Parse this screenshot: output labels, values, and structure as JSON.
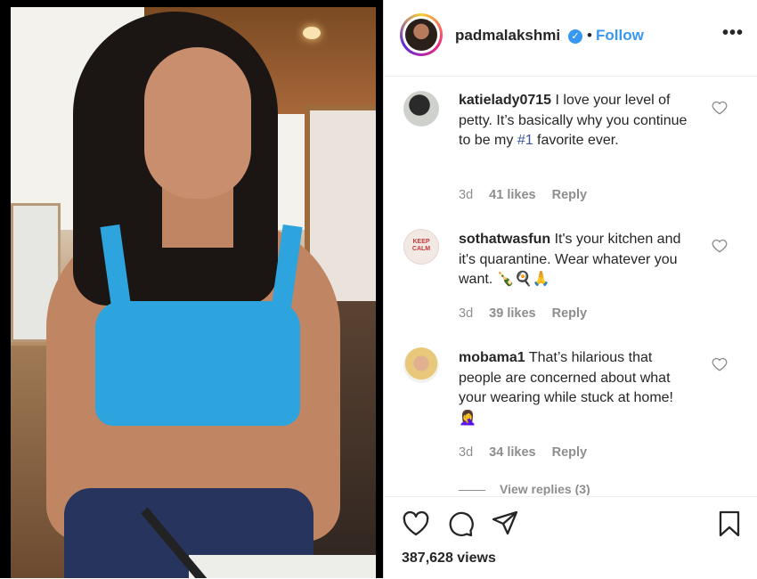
{
  "post": {
    "username": "padmalakshmi",
    "separator": "•",
    "follow_label": "Follow",
    "more_label": "•••",
    "verified_mark": "✓",
    "accent_color": "#3897f0"
  },
  "comments": [
    {
      "username": "katielady0715",
      "text_before": " I love your level of petty. It’s basically why you continue to be my ",
      "tag": "#1",
      "text_after": " favorite ever.",
      "age": "3d",
      "likes": "41 likes",
      "reply": "Reply"
    },
    {
      "username": "sothatwasfun",
      "text_before": " It's your kitchen and it's quarantine. Wear whatever you want. ",
      "tag": "",
      "text_after": "🍾🍳🙏",
      "age": "3d",
      "likes": "39 likes",
      "reply": "Reply",
      "avatar_text": "KEEP CALM"
    },
    {
      "username": "mobama1",
      "text_before": " That’s hilarious that people are concerned about what your wearing while stuck at home! ",
      "tag": "",
      "text_after": "🤦‍♀️",
      "age": "3d",
      "likes": "34 likes",
      "reply": "Reply"
    }
  ],
  "view_replies": "View replies (3)",
  "actions": {
    "like_icon": "heart-icon",
    "comment_icon": "comment-icon",
    "share_icon": "send-icon",
    "save_icon": "bookmark-icon"
  },
  "views": "387,628 views"
}
